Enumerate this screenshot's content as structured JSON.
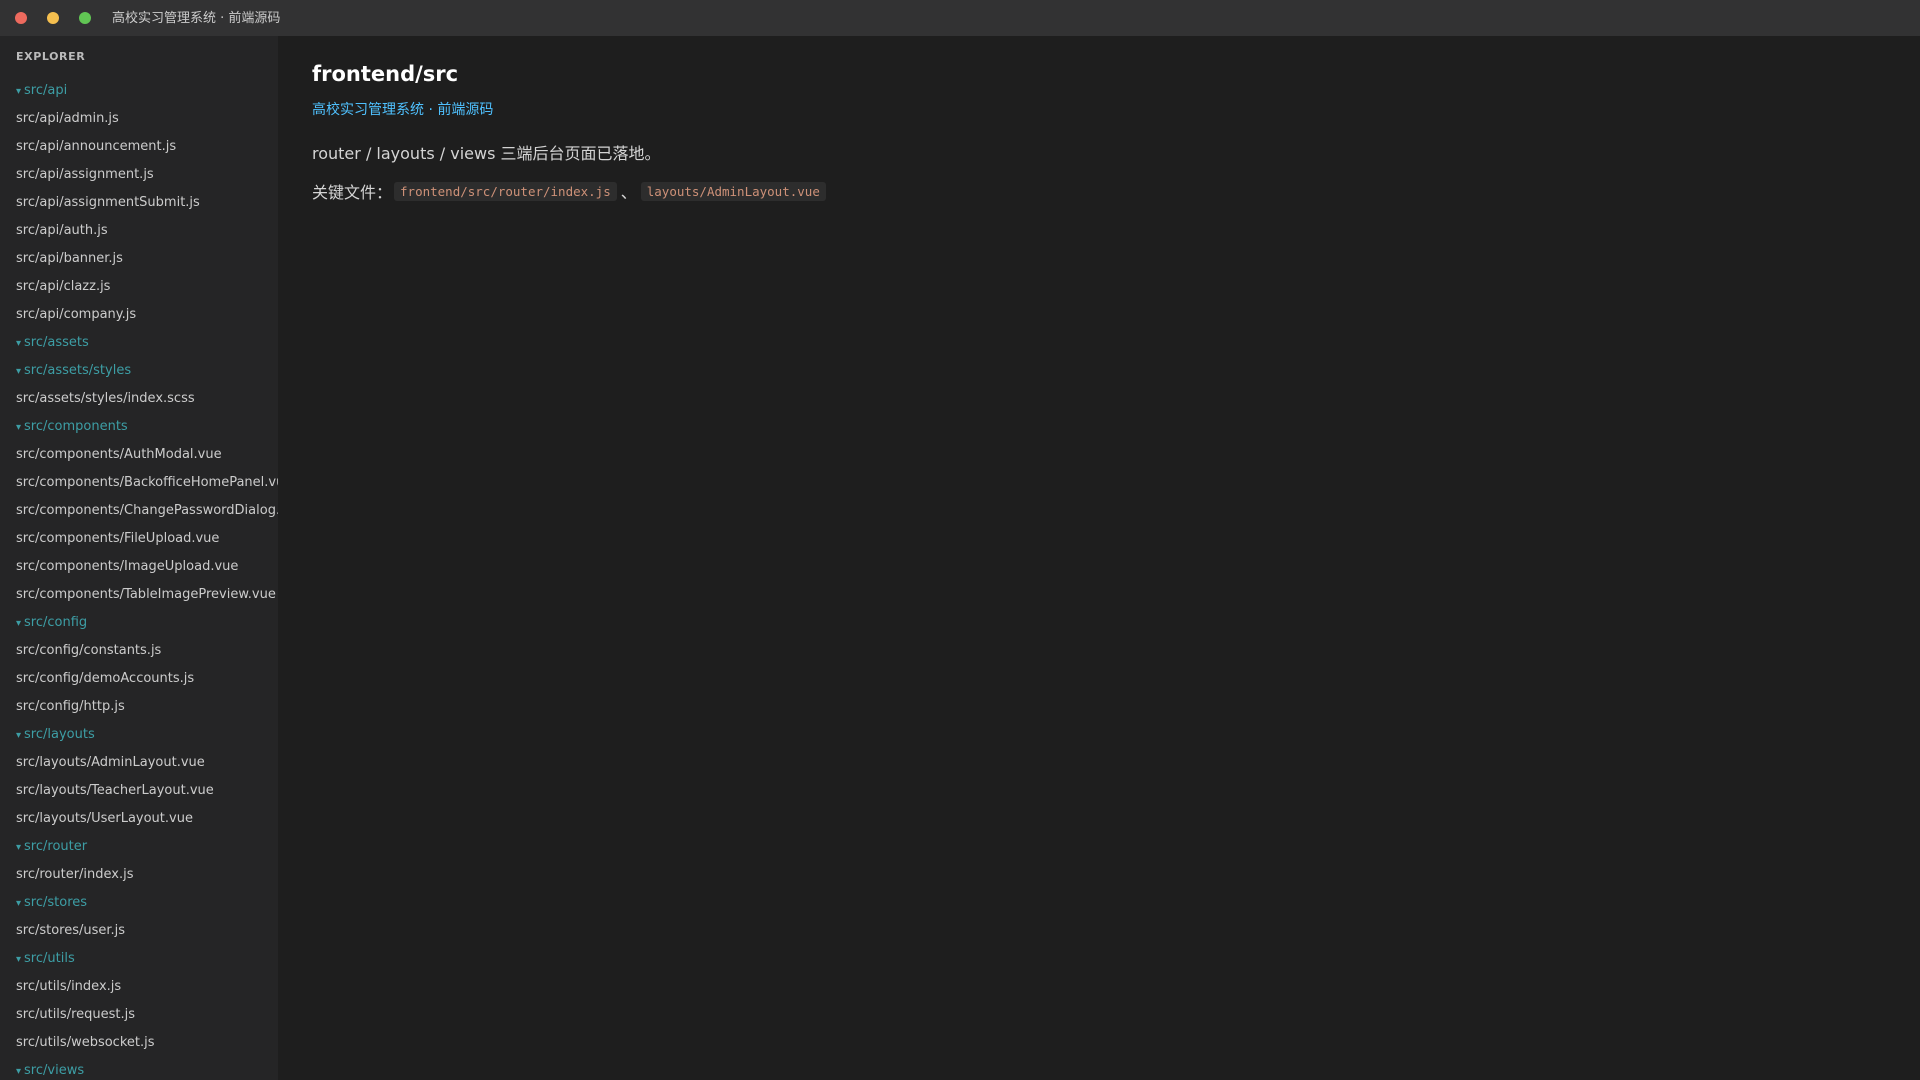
{
  "window": {
    "title": "高校实习管理系统 · 前端源码"
  },
  "sidebar": {
    "header": "EXPLORER",
    "folder_chevron": "▾",
    "items": [
      {
        "type": "folder",
        "label": "src/api"
      },
      {
        "type": "file",
        "label": "src/api/admin.js"
      },
      {
        "type": "file",
        "label": "src/api/announcement.js"
      },
      {
        "type": "file",
        "label": "src/api/assignment.js"
      },
      {
        "type": "file",
        "label": "src/api/assignmentSubmit.js"
      },
      {
        "type": "file",
        "label": "src/api/auth.js"
      },
      {
        "type": "file",
        "label": "src/api/banner.js"
      },
      {
        "type": "file",
        "label": "src/api/clazz.js"
      },
      {
        "type": "file",
        "label": "src/api/company.js"
      },
      {
        "type": "folder",
        "label": "src/assets"
      },
      {
        "type": "folder",
        "label": "src/assets/styles"
      },
      {
        "type": "file",
        "label": "src/assets/styles/index.scss"
      },
      {
        "type": "folder",
        "label": "src/components"
      },
      {
        "type": "file",
        "label": "src/components/AuthModal.vue"
      },
      {
        "type": "file",
        "label": "src/components/BackofficeHomePanel.vue"
      },
      {
        "type": "file",
        "label": "src/components/ChangePasswordDialog.vue"
      },
      {
        "type": "file",
        "label": "src/components/FileUpload.vue"
      },
      {
        "type": "file",
        "label": "src/components/ImageUpload.vue"
      },
      {
        "type": "file",
        "label": "src/components/TableImagePreview.vue"
      },
      {
        "type": "folder",
        "label": "src/config"
      },
      {
        "type": "file",
        "label": "src/config/constants.js"
      },
      {
        "type": "file",
        "label": "src/config/demoAccounts.js"
      },
      {
        "type": "file",
        "label": "src/config/http.js"
      },
      {
        "type": "folder",
        "label": "src/layouts"
      },
      {
        "type": "file",
        "label": "src/layouts/AdminLayout.vue"
      },
      {
        "type": "file",
        "label": "src/layouts/TeacherLayout.vue"
      },
      {
        "type": "file",
        "label": "src/layouts/UserLayout.vue"
      },
      {
        "type": "folder",
        "label": "src/router"
      },
      {
        "type": "file",
        "label": "src/router/index.js"
      },
      {
        "type": "folder",
        "label": "src/stores"
      },
      {
        "type": "file",
        "label": "src/stores/user.js"
      },
      {
        "type": "folder",
        "label": "src/utils"
      },
      {
        "type": "file",
        "label": "src/utils/index.js"
      },
      {
        "type": "file",
        "label": "src/utils/request.js"
      },
      {
        "type": "file",
        "label": "src/utils/websocket.js"
      },
      {
        "type": "folder",
        "label": "src/views"
      }
    ]
  },
  "main": {
    "heading": "frontend/src",
    "subtitle": "高校实习管理系统 · 前端源码",
    "description": "router / layouts / views 三端后台页面已落地。",
    "key_files_label": "关键文件：",
    "key_files": [
      "frontend/src/router/index.js",
      "layouts/AdminLayout.vue"
    ],
    "separator": "、"
  },
  "colors": {
    "close": "#ed6a5e",
    "minimize": "#f5bf4f",
    "maximize": "#61c554",
    "folder": "#3d9ea5",
    "link": "#4fc1ff",
    "code": "#ce9178"
  }
}
